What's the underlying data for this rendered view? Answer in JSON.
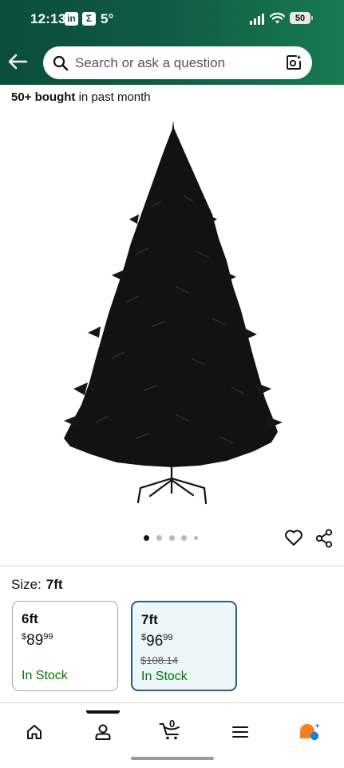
{
  "status_bar": {
    "time": "12:13",
    "icon1": "in",
    "icon2": "Σ",
    "temperature": "5°",
    "battery": "50"
  },
  "search": {
    "placeholder": "Search or ask a question"
  },
  "social_proof": {
    "bold": "50+ bought",
    "rest": " in past month"
  },
  "gallery": {
    "image_count": 5,
    "active_index": 0
  },
  "size": {
    "label": "Size:",
    "selected": "7ft",
    "options": [
      {
        "name": "6ft",
        "price_whole": "89",
        "price_fraction": "99",
        "currency": "$",
        "was": "",
        "stock": "In Stock",
        "selected": false
      },
      {
        "name": "7ft",
        "price_whole": "96",
        "price_fraction": "99",
        "currency": "$",
        "was": "$108.14",
        "stock": "In Stock",
        "selected": true
      }
    ]
  },
  "cart": {
    "count": "0"
  },
  "colors": {
    "header_start": "#0b4d3c",
    "header_end": "#177a52",
    "in_stock": "#007600",
    "selected_border": "#2a5f7f"
  }
}
